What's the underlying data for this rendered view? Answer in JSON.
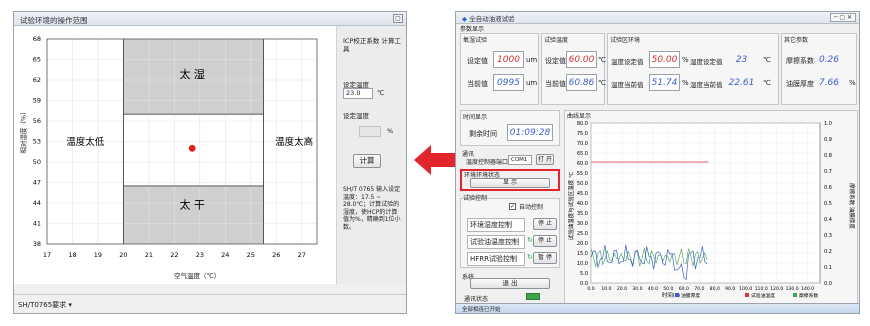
{
  "left_window": {
    "title": "试验环境的操作范围",
    "status": "SH/T0765要求 ▾",
    "y_axis_label": "相对湿度（%）",
    "x_axis_label": "空气温度（℃）",
    "x_ticks": [
      "17",
      "18",
      "19",
      "20",
      "21",
      "22",
      "23",
      "24",
      "25",
      "26",
      "27"
    ],
    "y_ticks": [
      "68",
      "65",
      "62",
      "59",
      "56",
      "53",
      "50",
      "47",
      "44",
      "41",
      "38"
    ],
    "regions": {
      "humid": "太 湿",
      "dry": "太 干",
      "cold": "温度太低",
      "hot": "温度太高"
    },
    "panel": {
      "tool_title": "ICP校正系数 计算工具",
      "set_temp_label": "设定温度",
      "set_temp_value": "23.0",
      "temp_unit": "℃",
      "set_hum_label": "设定湿度",
      "hum_unit": "%",
      "calc_button": "计算",
      "note": "SH/T 0765 输入设定温度：17.5 ~ 28.0℃；计算试验的湿度，使HCP的计算值为%，精确到1位小数。"
    },
    "point": {
      "temp": 22.7,
      "humidity": 52
    }
  },
  "arrow_color": "#e2242b",
  "right_window": {
    "title": "全自动油液试验",
    "top_groups": [
      "参数显示",
      "氧湿试验",
      "试验温度",
      "试验区环境",
      "其它参数"
    ],
    "rows": [
      {
        "a_label": "设定值",
        "a_value": "1000",
        "a_unit": "um",
        "b_label": "设定值",
        "b_value": "60.00",
        "b_unit": "℃",
        "c_label": "温度设定值",
        "c_value": "50.00",
        "c_unit": "%",
        "d_label": "湿度设定值",
        "d_value": "23",
        "d_unit": "℃",
        "e_label": "摩擦系数",
        "e_value": "0.26"
      },
      {
        "a_label": "当前值",
        "a_value": "0995",
        "a_unit": "um",
        "b_label": "当前值",
        "b_value": "60.86",
        "b_unit": "℃",
        "c_label": "温度当前值",
        "c_value": "51.74",
        "c_unit": "%",
        "d_label": "湿度当前值",
        "d_value": "22.61",
        "d_unit": "℃",
        "e_label": "油膜厚度",
        "e_value": "7.66",
        "e_unit": "%"
      }
    ],
    "time_group": "时间显示",
    "time_label": "剩余时间",
    "time_value": "01:09:28",
    "comm_group": "通讯",
    "comm_label": "温度控制器端口",
    "comm_value": "COM1",
    "comm_btn": "打 开",
    "env_group": "环境环境状态",
    "env_btn": "显 示",
    "ctrl_group": "试验控制",
    "auto_label": "自动控制",
    "ctrl_rows": [
      {
        "label": "环境湿度控制",
        "btn": "停 止"
      },
      {
        "label": "试验油温度控制",
        "btn": "停 止"
      },
      {
        "label": "HFRR试验控制",
        "btn": "暂 停"
      }
    ],
    "sys_group": "系统",
    "exit_btn": "退 出",
    "conn_label": "通讯状态",
    "status": "全部相连已开始",
    "chart": {
      "title": "曲线显示",
      "ylabel_left": "试验油温度与试验区温度 ℃",
      "ylabel_right": "摩擦系数 油膜厚度",
      "xlabel": "时间(s)",
      "y_ticks": [
        "80.0",
        "75.0",
        "70.0",
        "65.0",
        "60.0",
        "55.0",
        "50.0",
        "45.0",
        "40.0",
        "35.0",
        "30.0",
        "25.0",
        "20.0",
        "15.0",
        "10.0",
        "5.0",
        "0.0"
      ],
      "y2_ticks": [
        "1.0",
        "0.9",
        "0.8",
        "0.7",
        "0.6",
        "0.5",
        "0.4",
        "0.3",
        "0.2",
        "0.1",
        "0.0"
      ],
      "x_ticks": [
        "0.0",
        "10.0",
        "20.0",
        "30.0",
        "40.0",
        "50.0",
        "60.0",
        "70.0",
        "80.0",
        "90.0",
        "100.0",
        "110.0",
        "120.0",
        "130.0",
        "140.0"
      ],
      "legend": [
        "油膜厚度",
        "试验油温度",
        "摩擦系数"
      ],
      "legend_colors": [
        "#3a5fc8",
        "#d9342b",
        "#3ca34a"
      ],
      "red_level": 60.5
    }
  }
}
